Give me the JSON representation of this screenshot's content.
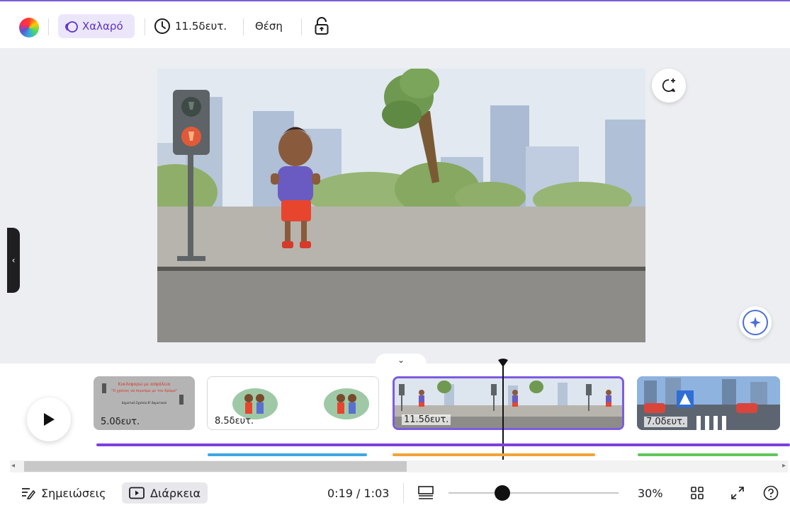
{
  "toolbar": {
    "animation_label": "Χαλαρό",
    "duration_label": "11.5δευτ.",
    "position_label": "Θέση",
    "icons": [
      "color-wheel-icon",
      "animate-icon",
      "clock-icon",
      "lock-icon"
    ]
  },
  "canvas": {
    "side_handle": "‹",
    "collapse_glyph": "⌄",
    "icons": [
      "comment-add-icon",
      "magic-sparkle-icon"
    ]
  },
  "slide1": {
    "title_line1": "Κυκλοφορώ με ασφάλεια",
    "title_line2": "\"Ο χρόνος να περνάμε με τον δρόμο\"",
    "subtitle": "Δημοτικό Σχολείο Β' Δημοτικού"
  },
  "clips": [
    {
      "duration": "5.0δευτ."
    },
    {
      "duration": "8.5δευτ."
    },
    {
      "duration": "11.5δευτ."
    },
    {
      "duration": "7.0δευτ."
    }
  ],
  "bottom": {
    "notes_label": "Σημειώσεις",
    "duration_label": "Διάρκεια",
    "time": "0:19 / 1:03",
    "zoom": "30%",
    "zoom_fraction": 0.3
  },
  "colors": {
    "accent": "#7d3fe0",
    "audio_blue": "#3ea6e6",
    "audio_orange": "#f2a33a",
    "audio_green": "#5fc75a",
    "selected_border": "#7d5ce0"
  }
}
